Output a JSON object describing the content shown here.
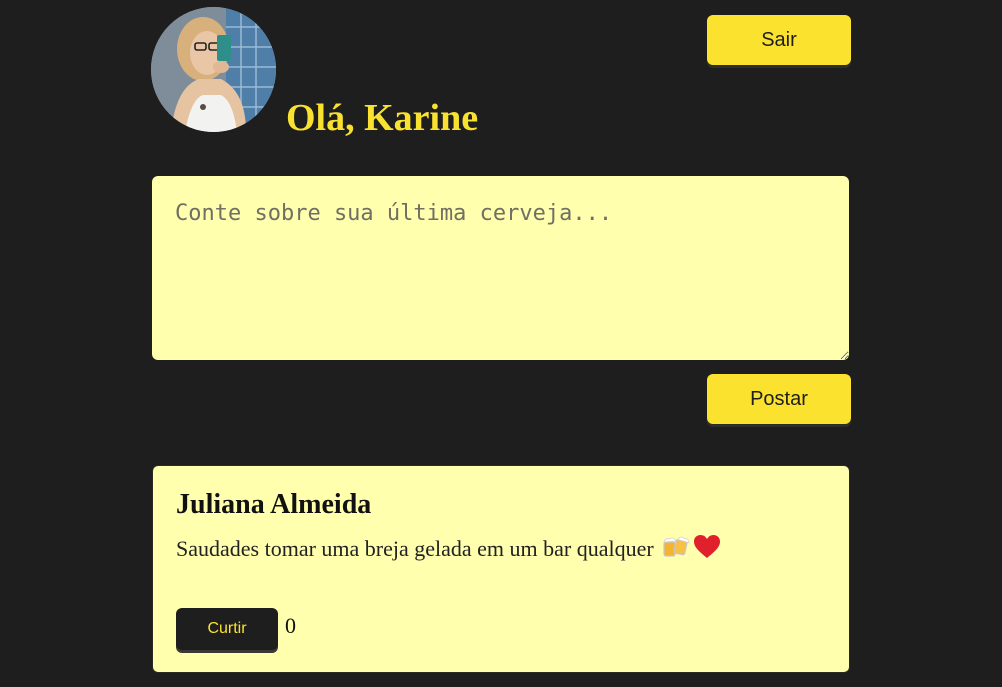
{
  "user": {
    "greeting": "Olá, Karine",
    "avatar_alt": "avatar"
  },
  "header": {
    "logout_label": "Sair"
  },
  "composer": {
    "placeholder": "Conte sobre sua última cerveja...",
    "value": "",
    "post_label": "Postar"
  },
  "feed": {
    "posts": [
      {
        "author": "Juliana Almeida",
        "text": "Saudades tomar uma breja gelada em um bar qualquer",
        "emojis": [
          "beer-mugs-icon",
          "heart-icon"
        ],
        "like_label": "Curtir",
        "likes": "0"
      }
    ]
  },
  "colors": {
    "background": "#1e1e1e",
    "accent_yellow": "#fae22e",
    "card_yellow": "#ffffad",
    "heart_red": "#e0202a"
  }
}
